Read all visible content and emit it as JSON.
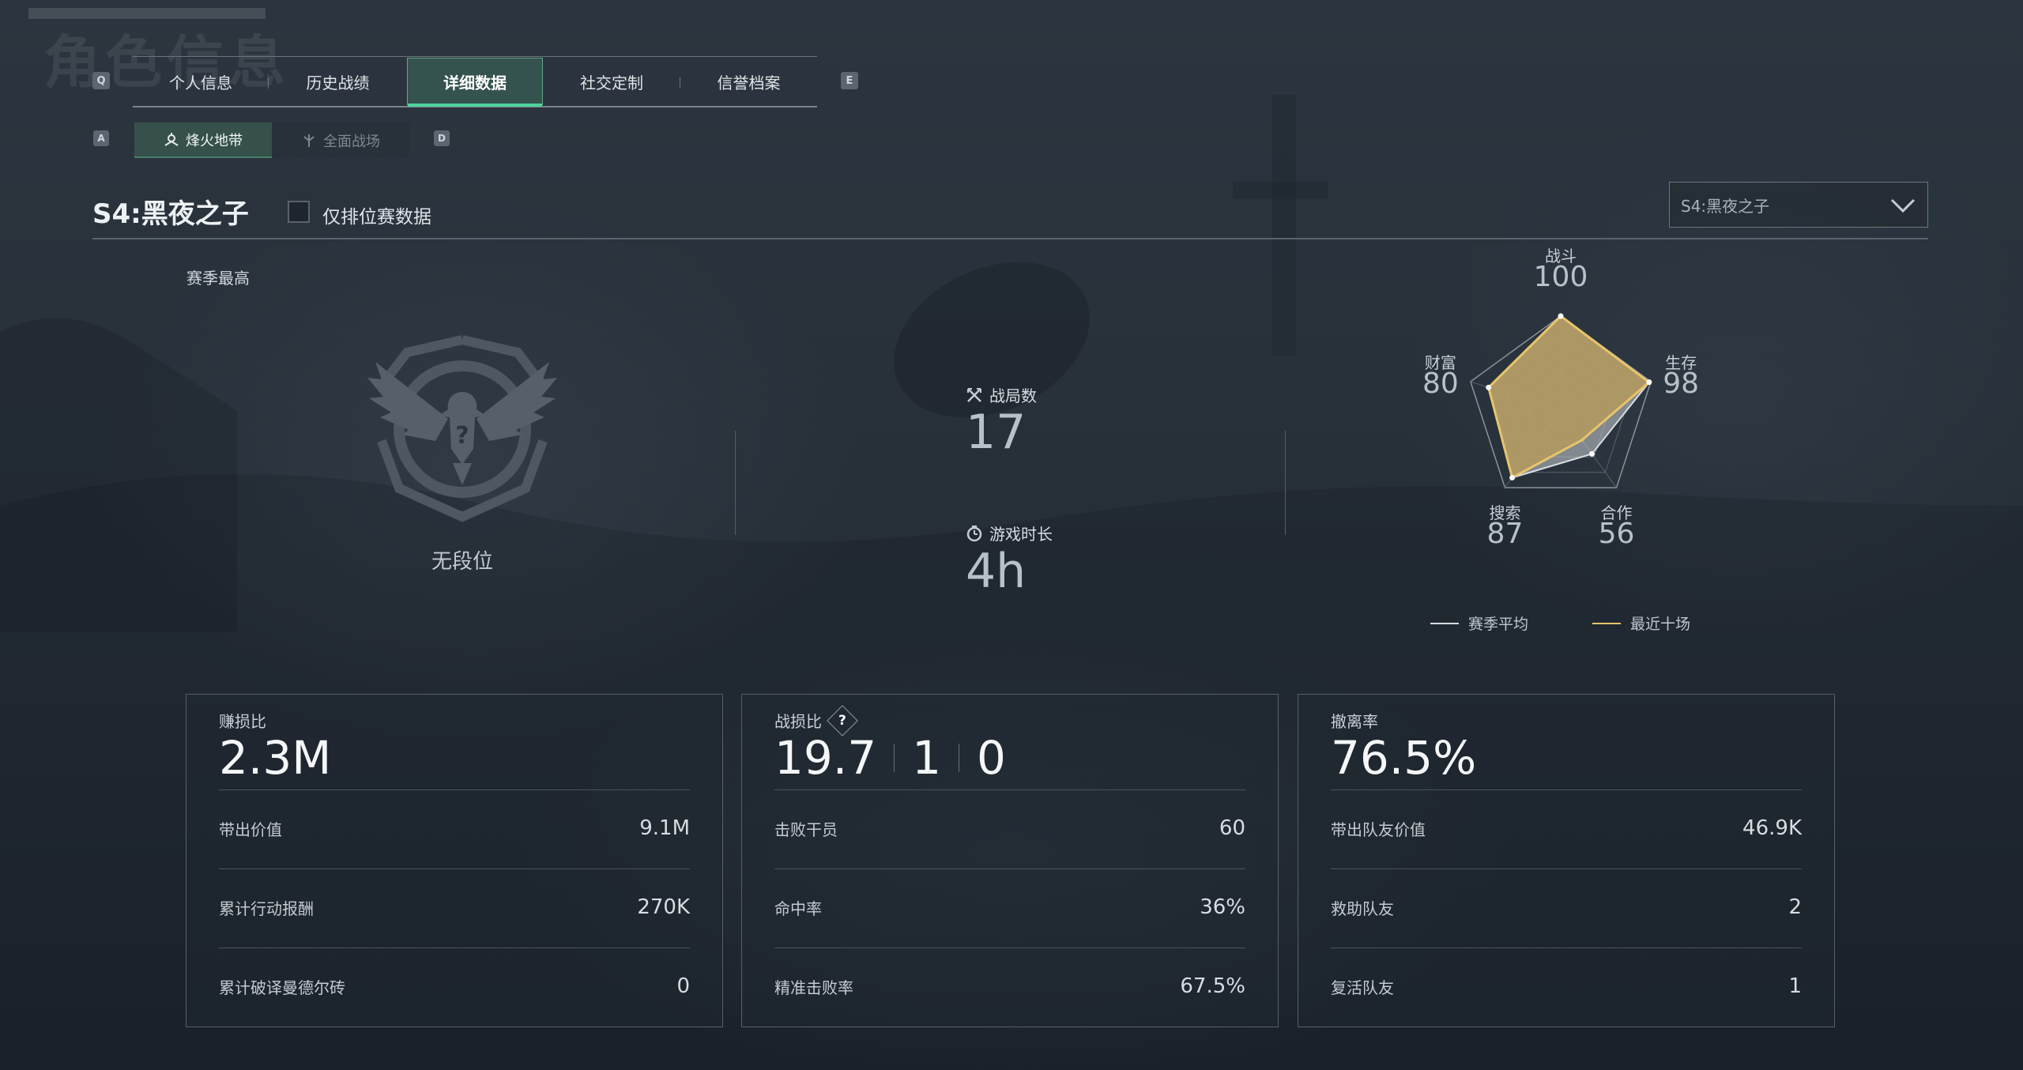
{
  "page": {
    "ghost_title": "角色信息"
  },
  "tabs": {
    "prev_key": "Q",
    "next_key": "E",
    "items": [
      {
        "label": "个人信息"
      },
      {
        "label": "历史战绩"
      },
      {
        "label": "详细数据"
      },
      {
        "label": "社交定制"
      },
      {
        "label": "信誉档案"
      }
    ],
    "active_index": 2
  },
  "mode_tabs": {
    "prev_key": "A",
    "next_key": "D",
    "items": [
      {
        "label": "烽火地带",
        "icon": "fire-zone-icon"
      },
      {
        "label": "全面战场",
        "icon": "battlefield-icon"
      }
    ],
    "active_index": 0
  },
  "season": {
    "title": "S4:黑夜之子",
    "ranked_only_label": "仅排位赛数据",
    "ranked_only_checked": false,
    "dropdown_value": "S4:黑夜之子"
  },
  "rank": {
    "section_label": "赛季最高",
    "emblem_icon": "eagle-rank-emblem-icon",
    "rank_text": "无段位"
  },
  "overview": {
    "matches_label": "战局数",
    "matches_value": "17",
    "playtime_label": "游戏时长",
    "playtime_value": "4h"
  },
  "radar": {
    "axes": [
      {
        "label": "战斗",
        "value": "100",
        "season_avg": 100,
        "recent_ten": 100
      },
      {
        "label": "生存",
        "value": "98",
        "season_avg": 98,
        "recent_ten": 98
      },
      {
        "label": "合作",
        "value": "56",
        "season_avg": 56,
        "recent_ten": 38
      },
      {
        "label": "搜索",
        "value": "87",
        "season_avg": 87,
        "recent_ten": 87
      },
      {
        "label": "财富",
        "value": "80",
        "season_avg": 80,
        "recent_ten": 80
      }
    ],
    "legend": [
      {
        "label": "赛季平均",
        "color": "#d8dde2"
      },
      {
        "label": "最近十场",
        "color": "#e8c46b"
      }
    ]
  },
  "cards": [
    {
      "title": "赚损比",
      "big": [
        "2.3M"
      ],
      "rows": [
        {
          "label": "带出价值",
          "value": "9.1M"
        },
        {
          "label": "累计行动报酬",
          "value": "270K"
        },
        {
          "label": "累计破译曼德尔砖",
          "value": "0"
        }
      ]
    },
    {
      "title": "战损比",
      "has_help": true,
      "help_glyph": "?",
      "big": [
        "19.7",
        "1",
        "0"
      ],
      "rows": [
        {
          "label": "击败干员",
          "value": "60"
        },
        {
          "label": "命中率",
          "value": "36%"
        },
        {
          "label": "精准击败率",
          "value": "67.5%"
        }
      ]
    },
    {
      "title": "撤离率",
      "big": [
        "76.5%"
      ],
      "rows": [
        {
          "label": "带出队友价值",
          "value": "46.9K"
        },
        {
          "label": "救助队友",
          "value": "2"
        },
        {
          "label": "复活队友",
          "value": "1"
        }
      ]
    }
  ],
  "colors": {
    "accent_green": "#4fd39b",
    "radar_fill": "#b59a5e",
    "radar_recent_stroke": "#e8c46b"
  }
}
